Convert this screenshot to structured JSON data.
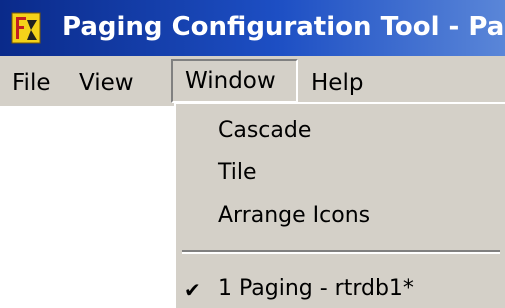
{
  "titlebar": {
    "title": "Paging Configuration Tool - Pag",
    "icon": "app-icon"
  },
  "menubar": {
    "items": [
      {
        "label": "File"
      },
      {
        "label": "View"
      },
      {
        "label": "Window",
        "state": "open"
      },
      {
        "label": "Help"
      }
    ]
  },
  "window_menu": {
    "items": [
      {
        "label": "Cascade"
      },
      {
        "label": "Tile"
      },
      {
        "label": "Arrange Icons"
      }
    ],
    "open_windows": [
      {
        "label": "1 Paging - rtrdb1*",
        "checked": true,
        "check_icon": "checkmark-icon"
      }
    ]
  },
  "colors": {
    "titlebar_start": "#0a2a8a",
    "titlebar_end": "#5a86d8",
    "menu_face": "#d4d0c8",
    "text": "#000000",
    "title_text": "#ffffff"
  }
}
